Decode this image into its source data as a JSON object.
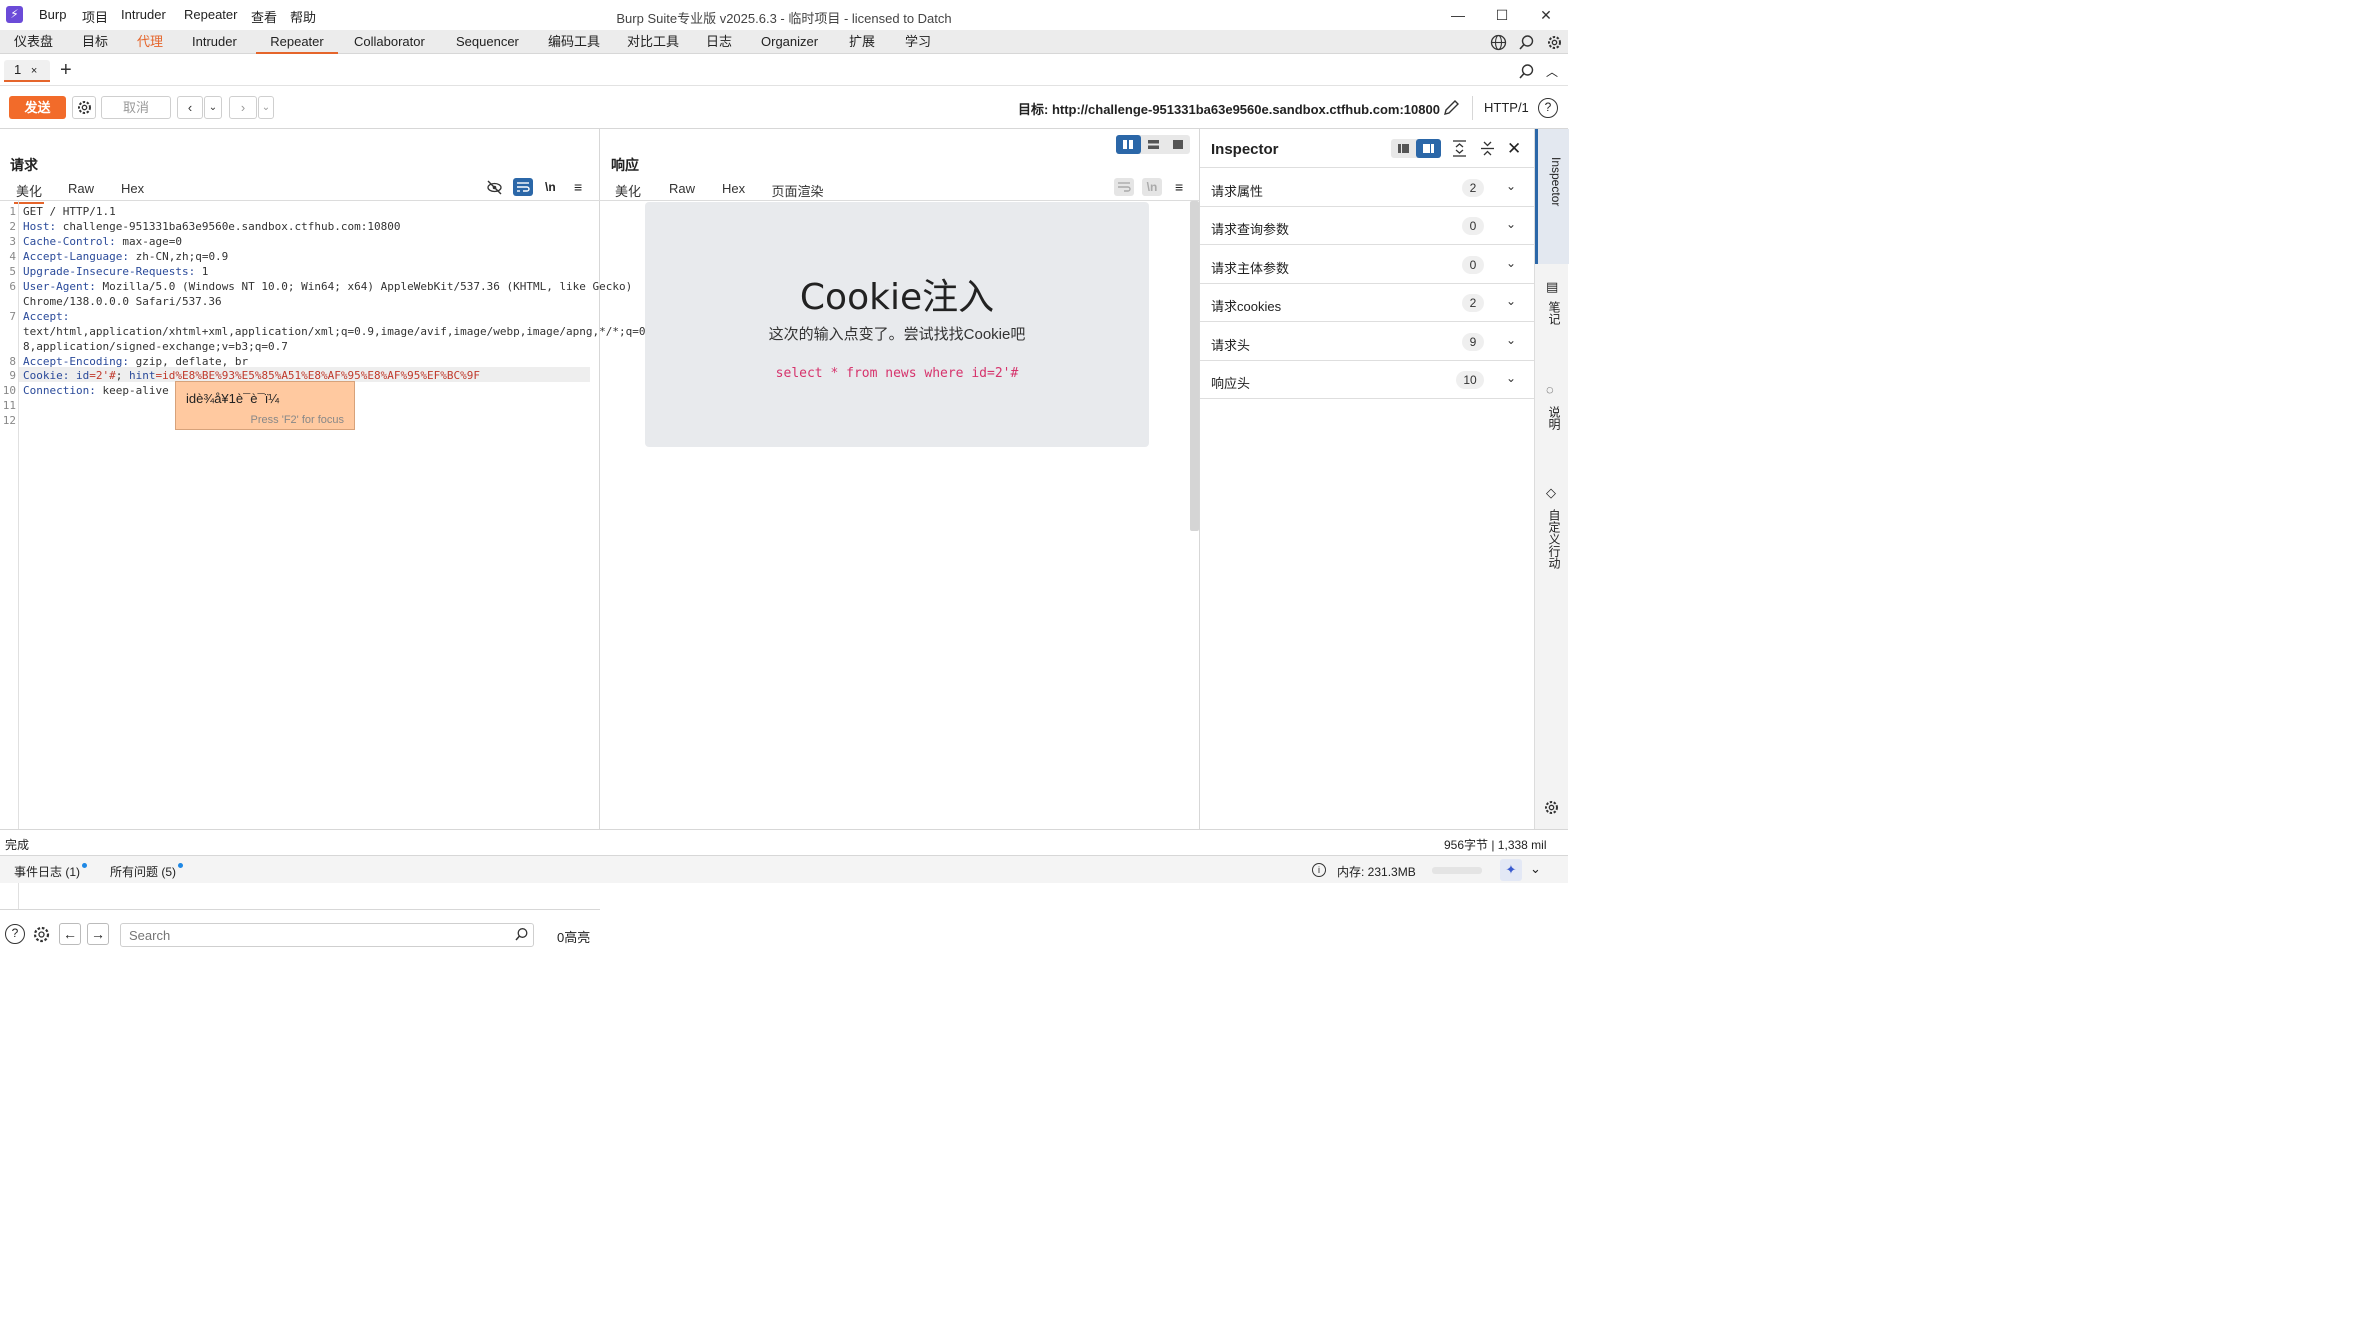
{
  "menu": [
    "Burp",
    "项目",
    "Intruder",
    "Repeater",
    "查看",
    "帮助"
  ],
  "window_title": "Burp Suite专业版  v2025.6.3 - 临时项目 - licensed to Datch",
  "main_tabs": [
    "仪表盘",
    "目标",
    "代理",
    "Intruder",
    "Repeater",
    "Collaborator",
    "Sequencer",
    "编码工具",
    "对比工具",
    "日志",
    "Organizer",
    "扩展",
    "学习"
  ],
  "sub_tab": {
    "label": "1",
    "close": "×"
  },
  "toolbar": {
    "send": "发送",
    "cancel": "取消",
    "target": "目标: http://challenge-951331ba63e9560e.sandbox.ctfhub.com:10800",
    "http_version": "HTTP/1"
  },
  "request": {
    "title": "请求",
    "view_tabs": [
      "美化",
      "Raw",
      "Hex"
    ],
    "newline_toggle": "\\n",
    "lines": [
      {
        "n": "1",
        "name": "",
        "value": "GET / HTTP/1.1"
      },
      {
        "n": "2",
        "name": "Host:",
        "value": " challenge-951331ba63e9560e.sandbox.ctfhub.com:10800"
      },
      {
        "n": "3",
        "name": "Cache-Control:",
        "value": " max-age=0"
      },
      {
        "n": "4",
        "name": "Accept-Language:",
        "value": " zh-CN,zh;q=0.9"
      },
      {
        "n": "5",
        "name": "Upgrade-Insecure-Requests:",
        "value": " 1"
      },
      {
        "n": "6",
        "name": "User-Agent:",
        "value": " Mozilla/5.0 (Windows NT 10.0; Win64; x64) AppleWebKit/537.36 (KHTML, like Gecko)"
      },
      {
        "n": "",
        "name": "",
        "value": "Chrome/138.0.0.0 Safari/537.36"
      },
      {
        "n": "7",
        "name": "Accept:",
        "value": ""
      },
      {
        "n": "",
        "name": "",
        "value": "text/html,application/xhtml+xml,application/xml;q=0.9,image/avif,image/webp,image/apng,*/*;q=0."
      },
      {
        "n": "",
        "name": "",
        "value": "8,application/signed-exchange;v=b3;q=0.7"
      },
      {
        "n": "8",
        "name": "Accept-Encoding:",
        "value": " gzip, deflate, br"
      },
      {
        "n": "9",
        "name": "Cookie:",
        "value": ""
      },
      {
        "n": "10",
        "name": "Connection:",
        "value": " keep-alive"
      },
      {
        "n": "11",
        "name": "",
        "value": ""
      },
      {
        "n": "12",
        "name": "",
        "value": ""
      }
    ],
    "cookie_id_name": " id",
    "cookie_id_value": "=2'#",
    "cookie_sep": "; ",
    "cookie_hint_name": "hint",
    "cookie_hint_value": "=id%E8%BE%93%E5%85%A51%E8%AF%95%E8%AF%95%EF%BC%9F",
    "tooltip_text": "idè¾å¥1è¯è¯ï¼",
    "tooltip_hint": "Press 'F2' for focus",
    "search_placeholder": "Search",
    "highlights": "0高亮"
  },
  "response": {
    "title": "响应",
    "view_tabs": [
      "美化",
      "Raw",
      "Hex",
      "页面渲染"
    ],
    "newline_toggle": "\\n",
    "rendered": {
      "heading": "Cookie注入",
      "subtitle": "这次的输入点变了。尝试找找Cookie吧",
      "sql": "select * from news where id=2'#"
    }
  },
  "inspector": {
    "title": "Inspector",
    "rows": [
      {
        "label": "请求属性",
        "count": "2"
      },
      {
        "label": "请求查询参数",
        "count": "0"
      },
      {
        "label": "请求主体参数",
        "count": "0"
      },
      {
        "label": "请求cookies",
        "count": "2"
      },
      {
        "label": "请求头",
        "count": "9"
      },
      {
        "label": "响应头",
        "count": "10"
      }
    ]
  },
  "right_strip_labels": [
    "Inspector",
    "笔记",
    "说明",
    "自定义行动"
  ],
  "status": {
    "left": "完成",
    "right": "956字节 | 1,338 mil"
  },
  "footer": {
    "event_log": "事件日志 (1)",
    "issues": "所有问题 (5)",
    "memory": "内存: 231.3MB"
  },
  "colors": {
    "accent": "#e5652b",
    "send": "#f26b2a",
    "header_name": "#2a4a9a",
    "cookie_value": "#c0392b",
    "sql": "#d6336c"
  }
}
